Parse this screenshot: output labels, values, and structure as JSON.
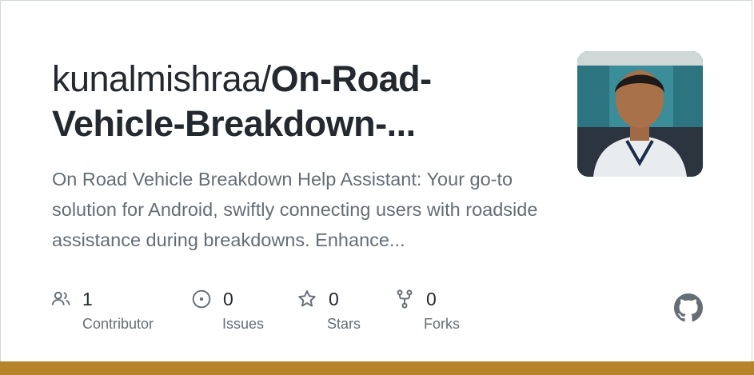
{
  "repo": {
    "owner": "kunalmishraa/",
    "name": "On-Road-Vehicle-Breakdown-...",
    "description": "On Road Vehicle Breakdown Help Assistant: Your go-to solution for Android, swiftly connecting users with roadside assistance during breakdowns. Enhance..."
  },
  "avatar": {
    "alt": "owner-avatar"
  },
  "stats": {
    "contributors": {
      "count": "1",
      "label": "Contributor",
      "icon": "people-icon"
    },
    "issues": {
      "count": "0",
      "label": "Issues",
      "icon": "issue-opened-icon"
    },
    "stars": {
      "count": "0",
      "label": "Stars",
      "icon": "star-icon"
    },
    "forks": {
      "count": "0",
      "label": "Forks",
      "icon": "repo-forked-icon"
    }
  },
  "brand": {
    "icon": "github-mark-icon"
  },
  "colors": {
    "accent_bar": "#b5842b",
    "title": "#24292f",
    "muted": "#656d76"
  }
}
